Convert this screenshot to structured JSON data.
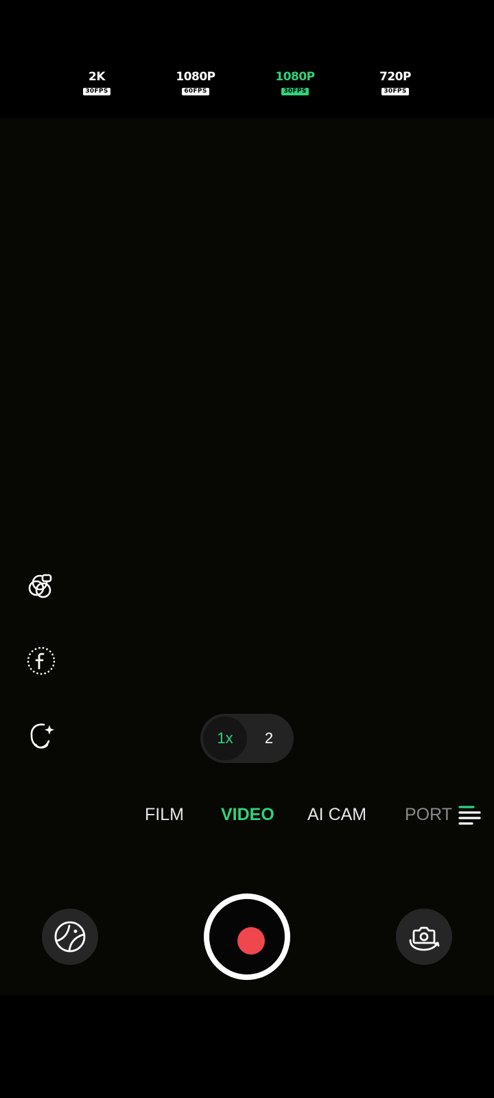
{
  "resolution_options": [
    {
      "resolution": "2K",
      "fps": "30FPS",
      "active": false
    },
    {
      "resolution": "1080P",
      "fps": "60FPS",
      "active": false
    },
    {
      "resolution": "1080P",
      "fps": "30FPS",
      "active": true
    },
    {
      "resolution": "720P",
      "fps": "30FPS",
      "active": false
    }
  ],
  "zoom": {
    "active_label": "1x",
    "other_label": "2"
  },
  "modes": {
    "film": "FILM",
    "video": "VIDEO",
    "ai_cam": "AI CAM",
    "portrait_partial": "PORT",
    "active": "VIDEO"
  },
  "side_tools": [
    "filter-effects-icon",
    "filter-f-icon",
    "beauty-face-icon"
  ],
  "bottom_controls": {
    "gallery_icon": "gallery-thumbnail-icon",
    "record_icon": "record-icon",
    "flip_icon": "flip-camera-icon"
  },
  "colors": {
    "accent": "#2fd27a",
    "record": "#f0464e",
    "viewfinder": "#070704"
  }
}
